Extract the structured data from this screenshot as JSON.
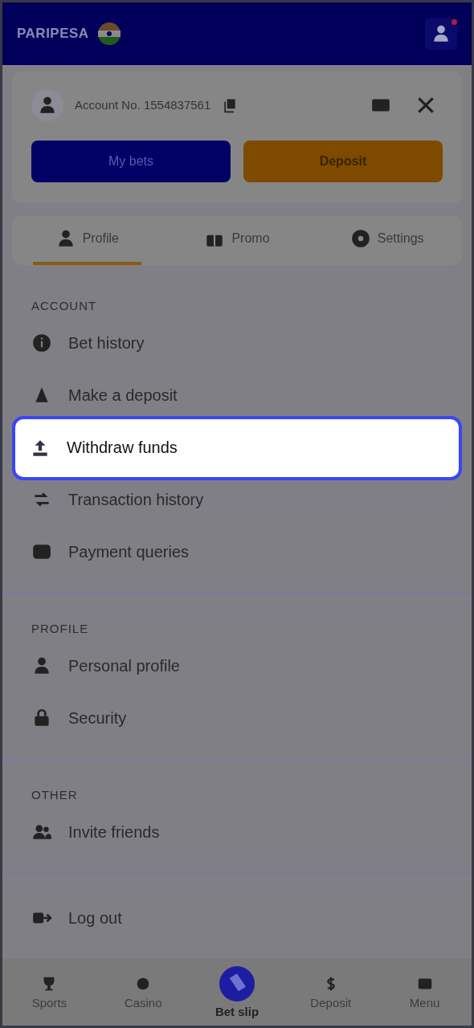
{
  "header": {
    "logo": "PARIPESA",
    "has_notification": true
  },
  "account": {
    "number": "Account No. 1554837561"
  },
  "buttons": [
    {
      "label": "My bets",
      "kind": "primary"
    },
    {
      "label": "Deposit",
      "kind": "accent"
    }
  ],
  "tabs": [
    {
      "label": "Profile",
      "selected": true
    },
    {
      "label": "Promo",
      "selected": false
    },
    {
      "label": "Settings",
      "selected": false
    }
  ],
  "sections": [
    {
      "title": "ACCOUNT",
      "items": [
        {
          "label": "Bet history",
          "highlighted": false
        },
        {
          "label": "Make a deposit",
          "highlighted": false
        },
        {
          "label": "Withdraw funds",
          "highlighted": true
        },
        {
          "label": "Transaction history",
          "highlighted": false
        },
        {
          "label": "Payment queries",
          "highlighted": false
        }
      ]
    },
    {
      "title": "PROFILE",
      "items": [
        {
          "label": "Personal profile",
          "highlighted": false
        },
        {
          "label": "Security",
          "highlighted": false
        }
      ]
    },
    {
      "title": "OTHER",
      "items": [
        {
          "label": "Invite friends",
          "highlighted": false
        }
      ]
    },
    {
      "items": [
        {
          "label": "Log out",
          "highlighted": false
        }
      ]
    }
  ],
  "bottom_nav": [
    {
      "label": "Sports",
      "selected": false
    },
    {
      "label": "Casino",
      "selected": false
    },
    {
      "label": "Bet slip",
      "selected": true
    },
    {
      "label": "Deposit",
      "selected": false
    },
    {
      "label": "Menu",
      "selected": false
    }
  ]
}
